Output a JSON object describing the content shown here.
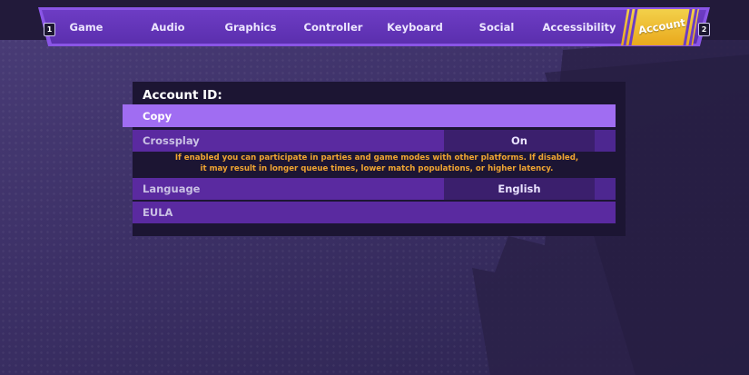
{
  "tabs": {
    "left_key": "1",
    "right_key": "2",
    "items": [
      "Game",
      "Audio",
      "Graphics",
      "Controller",
      "Keyboard",
      "Social",
      "Accessibility"
    ],
    "active": "Account"
  },
  "panel": {
    "title": "Account ID:",
    "copy_label": "Copy",
    "crossplay": {
      "label": "Crossplay",
      "value": "On",
      "description_line1": "If enabled you can participate in parties and game modes with other platforms. If disabled,",
      "description_line2": "it may result in longer queue times, lower match populations, or higher latency."
    },
    "language": {
      "label": "Language",
      "value": "English"
    },
    "eula_label": "EULA"
  },
  "colors": {
    "accent_gold": "#f0c43a",
    "tab_purple": "#6d3cc4",
    "highlight_row": "#a06df2",
    "description_orange": "#f0a531"
  }
}
